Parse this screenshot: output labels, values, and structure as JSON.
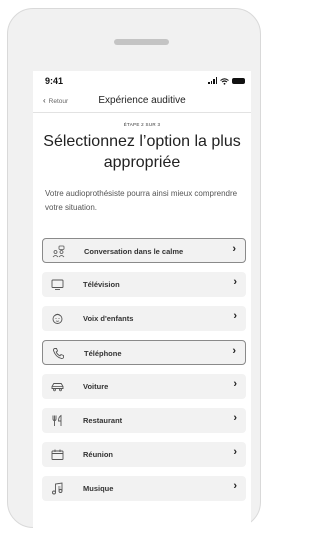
{
  "status_bar": {
    "time": "9:41"
  },
  "nav": {
    "back_label": "Retour",
    "title": "Expérience auditive"
  },
  "step_label": "ÉTAPE 2 SUR 3",
  "heading": "Sélectionnez l’option la plus appropriée",
  "description": "Votre audioprothésiste pourra ainsi mieux comprendre votre situation.",
  "options": [
    {
      "label": "Conversation dans le calme",
      "icon": "people-icon",
      "bordered": true
    },
    {
      "label": "Télévision",
      "icon": "tv-icon",
      "bordered": false
    },
    {
      "label": "Voix d'enfants",
      "icon": "child-face-icon",
      "bordered": false
    },
    {
      "label": "Téléphone",
      "icon": "phone-icon",
      "bordered": true
    },
    {
      "label": "Voiture",
      "icon": "car-icon",
      "bordered": false
    },
    {
      "label": "Restaurant",
      "icon": "fork-knife-icon",
      "bordered": false
    },
    {
      "label": "Réunion",
      "icon": "meeting-icon",
      "bordered": false
    },
    {
      "label": "Musique",
      "icon": "music-icon",
      "bordered": false
    }
  ],
  "chevron_glyph": "›",
  "colors": {
    "option_bg": "#f2f2f2",
    "option_border": "#8a8a8a",
    "device_bg": "#f1f1f1"
  }
}
